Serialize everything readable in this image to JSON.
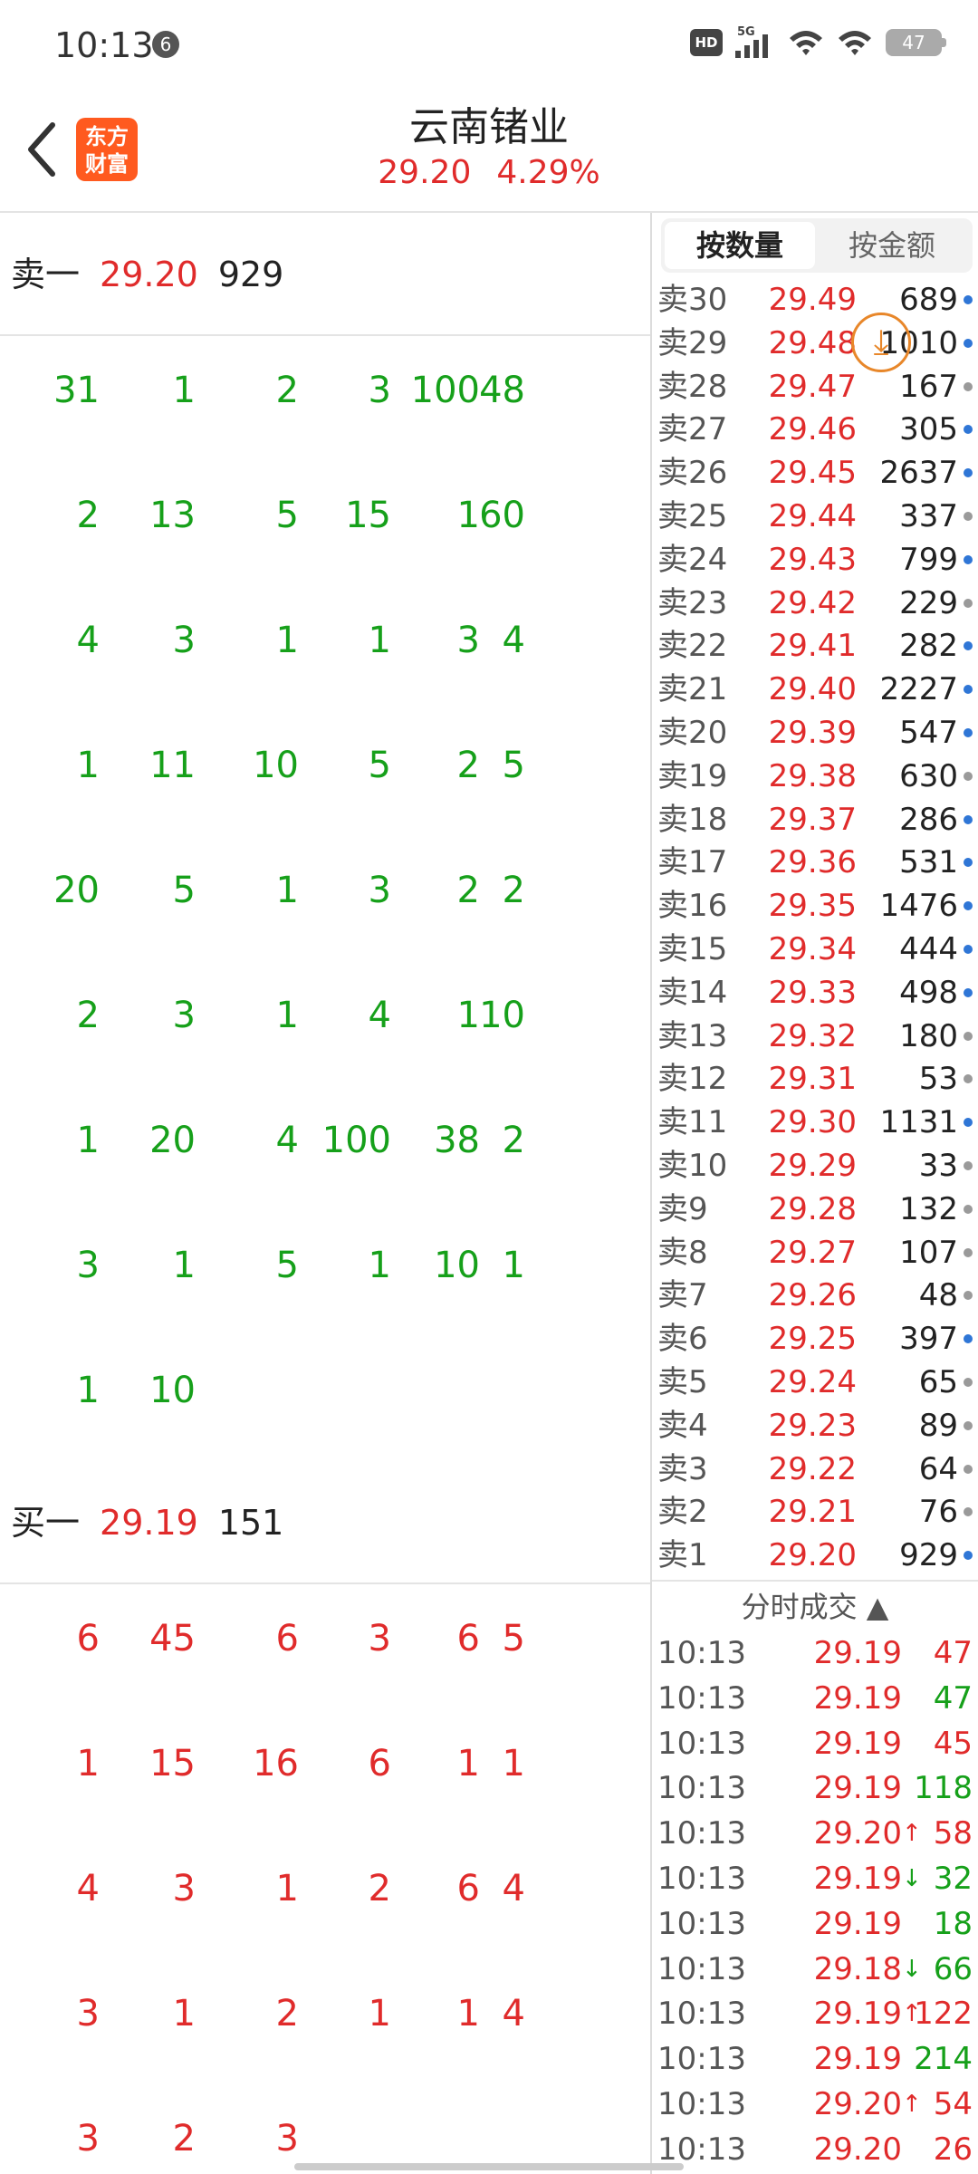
{
  "status_bar": {
    "time": "10:13",
    "notification_count": "6",
    "network_hd": "HD",
    "network_type": "5G",
    "battery": "47"
  },
  "header": {
    "title": "云南锗业",
    "logo_text": "东方\n财富",
    "price": "29.20",
    "change_pct": "4.29%"
  },
  "sell_section": {
    "label": "卖一",
    "price": "29.20",
    "volume": "929",
    "rows": [
      [
        "31",
        "1",
        "2",
        "3",
        "100",
        "48"
      ],
      [
        "2",
        "13",
        "5",
        "15",
        "1",
        "60"
      ],
      [
        "4",
        "3",
        "1",
        "1",
        "3",
        "4"
      ],
      [
        "1",
        "11",
        "10",
        "5",
        "2",
        "5"
      ],
      [
        "20",
        "5",
        "1",
        "3",
        "2",
        "2"
      ],
      [
        "2",
        "3",
        "1",
        "4",
        "1",
        "10"
      ],
      [
        "1",
        "20",
        "4",
        "100",
        "38",
        "2"
      ],
      [
        "3",
        "1",
        "5",
        "1",
        "10",
        "1"
      ],
      [
        "1",
        "10"
      ]
    ]
  },
  "buy_section": {
    "label": "买一",
    "price": "29.19",
    "volume": "151",
    "rows": [
      [
        "6",
        "45",
        "6",
        "3",
        "6",
        "5"
      ],
      [
        "1",
        "15",
        "16",
        "6",
        "1",
        "1"
      ],
      [
        "4",
        "3",
        "1",
        "2",
        "6",
        "4"
      ],
      [
        "3",
        "1",
        "2",
        "1",
        "1",
        "4"
      ],
      [
        "3",
        "2",
        "3"
      ]
    ]
  },
  "tabs": {
    "by_volume": "按数量",
    "by_amount": "按金额"
  },
  "asks": [
    {
      "label": "卖30",
      "price": "29.49",
      "volume": "689",
      "dot": "blue"
    },
    {
      "label": "卖29",
      "price": "29.48",
      "volume": "1010",
      "dot": "blue"
    },
    {
      "label": "卖28",
      "price": "29.47",
      "volume": "167",
      "dot": "gray"
    },
    {
      "label": "卖27",
      "price": "29.46",
      "volume": "305",
      "dot": "blue"
    },
    {
      "label": "卖26",
      "price": "29.45",
      "volume": "2637",
      "dot": "blue"
    },
    {
      "label": "卖25",
      "price": "29.44",
      "volume": "337",
      "dot": "gray"
    },
    {
      "label": "卖24",
      "price": "29.43",
      "volume": "799",
      "dot": "blue"
    },
    {
      "label": "卖23",
      "price": "29.42",
      "volume": "229",
      "dot": "gray"
    },
    {
      "label": "卖22",
      "price": "29.41",
      "volume": "282",
      "dot": "blue"
    },
    {
      "label": "卖21",
      "price": "29.40",
      "volume": "2227",
      "dot": "blue"
    },
    {
      "label": "卖20",
      "price": "29.39",
      "volume": "547",
      "dot": "blue"
    },
    {
      "label": "卖19",
      "price": "29.38",
      "volume": "630",
      "dot": "gray"
    },
    {
      "label": "卖18",
      "price": "29.37",
      "volume": "286",
      "dot": "blue"
    },
    {
      "label": "卖17",
      "price": "29.36",
      "volume": "531",
      "dot": "blue"
    },
    {
      "label": "卖16",
      "price": "29.35",
      "volume": "1476",
      "dot": "blue"
    },
    {
      "label": "卖15",
      "price": "29.34",
      "volume": "444",
      "dot": "blue"
    },
    {
      "label": "卖14",
      "price": "29.33",
      "volume": "498",
      "dot": "blue"
    },
    {
      "label": "卖13",
      "price": "29.32",
      "volume": "180",
      "dot": "gray"
    },
    {
      "label": "卖12",
      "price": "29.31",
      "volume": "53",
      "dot": "gray"
    },
    {
      "label": "卖11",
      "price": "29.30",
      "volume": "1131",
      "dot": "blue"
    },
    {
      "label": "卖10",
      "price": "29.29",
      "volume": "33",
      "dot": "gray"
    },
    {
      "label": "卖9",
      "price": "29.28",
      "volume": "132",
      "dot": "gray"
    },
    {
      "label": "卖8",
      "price": "29.27",
      "volume": "107",
      "dot": "gray"
    },
    {
      "label": "卖7",
      "price": "29.26",
      "volume": "48",
      "dot": "gray"
    },
    {
      "label": "卖6",
      "price": "29.25",
      "volume": "397",
      "dot": "blue"
    },
    {
      "label": "卖5",
      "price": "29.24",
      "volume": "65",
      "dot": "gray"
    },
    {
      "label": "卖4",
      "price": "29.23",
      "volume": "89",
      "dot": "gray"
    },
    {
      "label": "卖3",
      "price": "29.22",
      "volume": "64",
      "dot": "gray"
    },
    {
      "label": "卖2",
      "price": "29.21",
      "volume": "76",
      "dot": "gray"
    },
    {
      "label": "卖1",
      "price": "29.20",
      "volume": "929",
      "dot": "blue"
    }
  ],
  "ticks_title": "分时成交",
  "ticks": [
    {
      "time": "10:13",
      "price": "29.19",
      "arrow": "",
      "vol": "47",
      "vol_color": "red"
    },
    {
      "time": "10:13",
      "price": "29.19",
      "arrow": "",
      "vol": "47",
      "vol_color": "green"
    },
    {
      "time": "10:13",
      "price": "29.19",
      "arrow": "",
      "vol": "45",
      "vol_color": "red"
    },
    {
      "time": "10:13",
      "price": "29.19",
      "arrow": "",
      "vol": "118",
      "vol_color": "green"
    },
    {
      "time": "10:13",
      "price": "29.20",
      "arrow": "up",
      "vol": "58",
      "vol_color": "red"
    },
    {
      "time": "10:13",
      "price": "29.19",
      "arrow": "down",
      "vol": "32",
      "vol_color": "green"
    },
    {
      "time": "10:13",
      "price": "29.19",
      "arrow": "",
      "vol": "18",
      "vol_color": "green"
    },
    {
      "time": "10:13",
      "price": "29.18",
      "arrow": "down",
      "vol": "66",
      "vol_color": "green"
    },
    {
      "time": "10:13",
      "price": "29.19",
      "arrow": "up",
      "vol": "122",
      "vol_color": "red"
    },
    {
      "time": "10:13",
      "price": "29.19",
      "arrow": "",
      "vol": "214",
      "vol_color": "green"
    },
    {
      "time": "10:13",
      "price": "29.20",
      "arrow": "up",
      "vol": "54",
      "vol_color": "red"
    },
    {
      "time": "10:13",
      "price": "29.20",
      "arrow": "",
      "vol": "26",
      "vol_color": "red"
    }
  ],
  "colors": {
    "red": "#e02b2b",
    "green": "#16a01a",
    "accent": "#ff5a1f",
    "dot_blue": "#2f76d6",
    "dot_gray": "#9a9a9a"
  }
}
